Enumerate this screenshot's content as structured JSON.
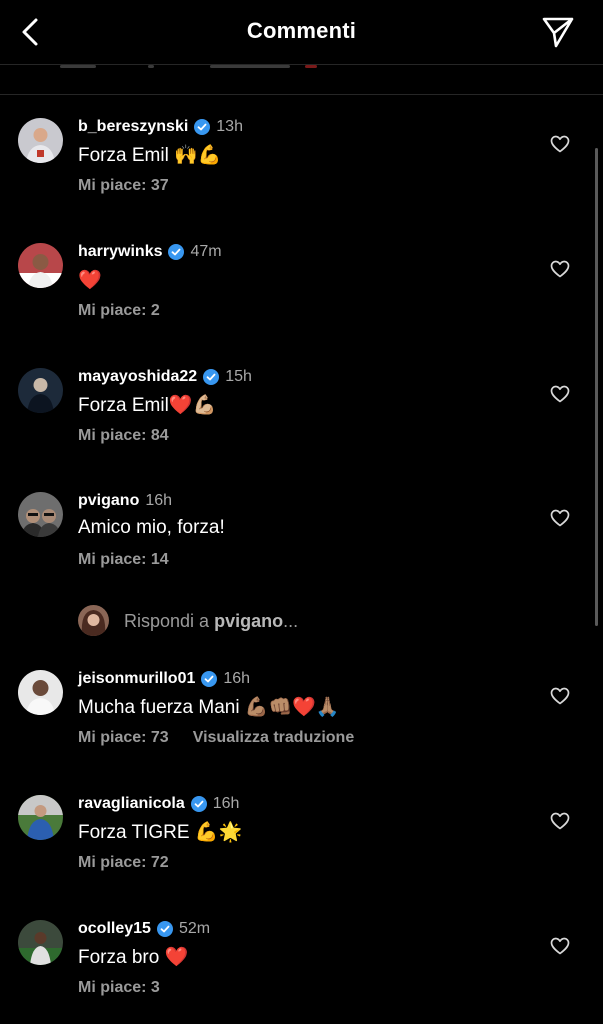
{
  "header": {
    "title": "Commenti",
    "back_icon": "chevron-left-icon",
    "send_icon": "paper-plane-icon"
  },
  "comments": [
    {
      "username": "b_bereszynski",
      "verified": true,
      "time": "13h",
      "text": "Forza Emil 🙌💪",
      "likes": "Mi piace: 37",
      "avatar_color": "#c9c9cf"
    },
    {
      "username": "harrywinks",
      "verified": true,
      "time": "47m",
      "text": "❤️",
      "likes": "Mi piace: 2",
      "avatar_color": "#b8474a"
    },
    {
      "username": "mayayoshida22",
      "verified": true,
      "time": "15h",
      "text": "Forza Emil❤️💪🏼",
      "likes": "Mi piace: 84",
      "avatar_color": "#1d2a3a"
    },
    {
      "username": "pvigano",
      "verified": false,
      "time": "16h",
      "text": "Amico mio, forza!",
      "likes": "Mi piace: 14",
      "avatar_color": "#6e6e6e"
    },
    {
      "username": "jeisonmurillo01",
      "verified": true,
      "time": "16h",
      "text": "Mucha fuerza Mani 💪🏽👊🏽❤️🙏🏽",
      "likes": "Mi piace: 73",
      "translate": "Visualizza traduzione",
      "avatar_color": "#9a9a9a"
    },
    {
      "username": "ravaglianicola",
      "verified": true,
      "time": "16h",
      "text": "Forza TIGRE 💪🌟",
      "likes": "Mi piace: 72",
      "avatar_color": "#2b5fb0"
    },
    {
      "username": "ocolley15",
      "verified": true,
      "time": "52m",
      "text": "Forza bro ❤️",
      "likes": "Mi piace: 3",
      "avatar_color": "#3c4a3c"
    }
  ],
  "reply": {
    "prefix": "Rispondi a",
    "target": "pvigano",
    "suffix": "..."
  },
  "colors": {
    "background": "#000000",
    "secondary_text": "#a8a8a8",
    "verified_badge": "#3897f0",
    "divider": "#262626"
  }
}
